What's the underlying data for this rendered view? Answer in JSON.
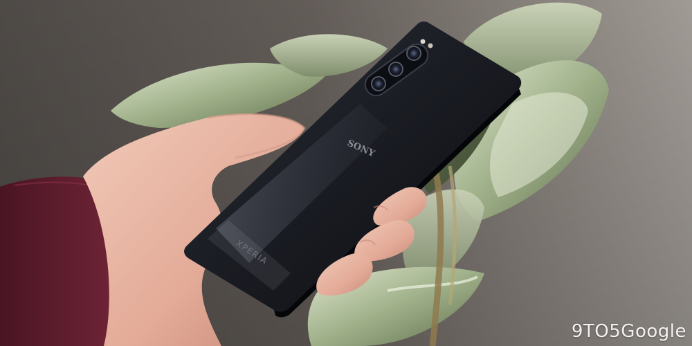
{
  "photo": {
    "phone_brand_text": "SONY",
    "phone_model_text": "XPERIA"
  },
  "watermark": {
    "text": "9TO5Google"
  }
}
